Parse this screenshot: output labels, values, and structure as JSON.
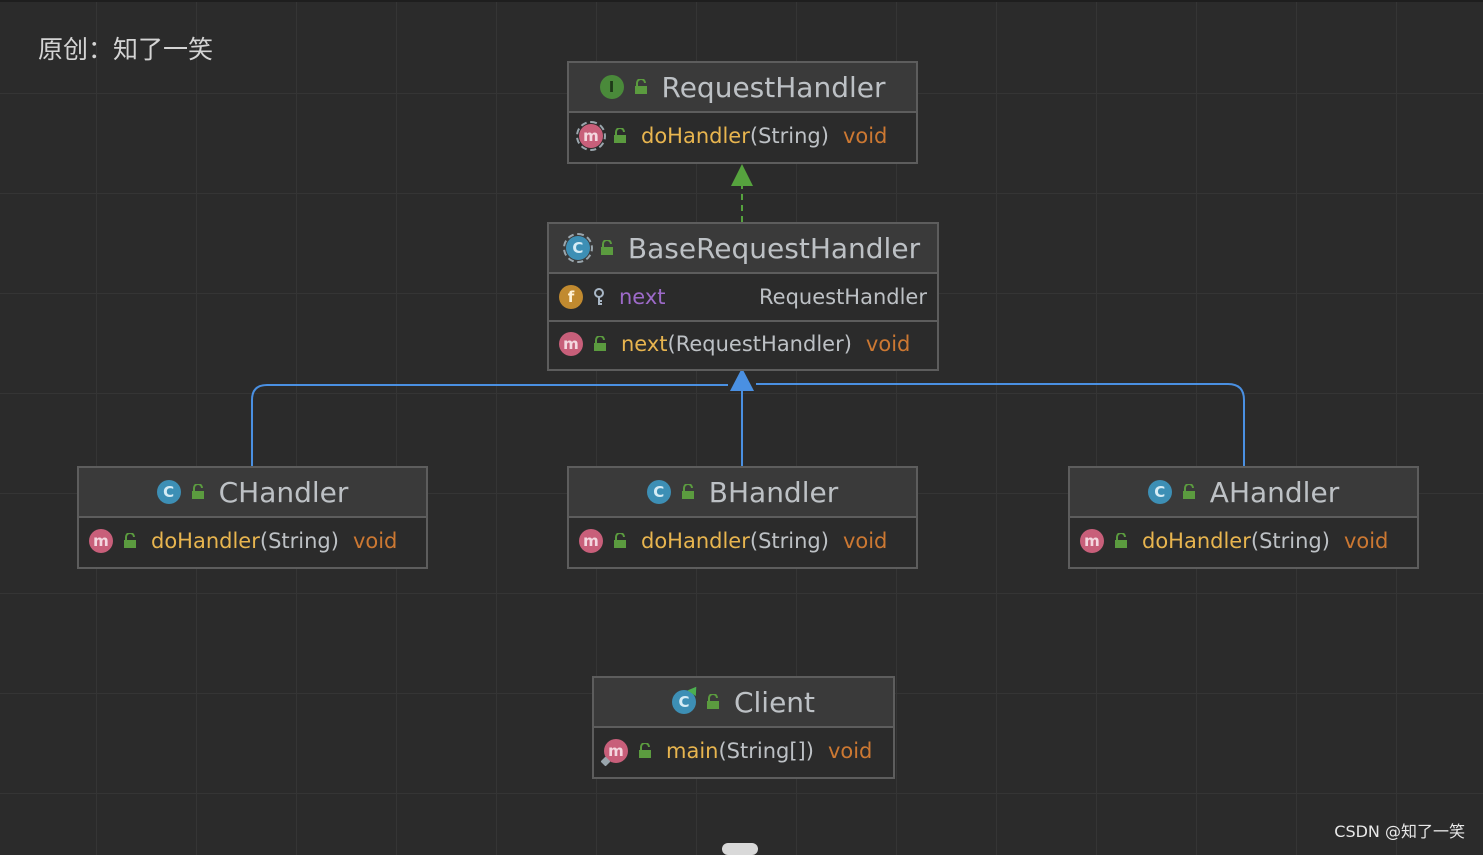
{
  "watermark": "原创：知了一笑",
  "footer_credit": "CSDN @知了一笑",
  "colors": {
    "background": "#2b2b2b",
    "implements_arrow": "#56a33e",
    "extends_arrow": "#4a90e2",
    "method_name": "#e8b54f",
    "return_type": "#cc7832",
    "field_name": "#9d6ac9"
  },
  "nodes": {
    "request_handler": {
      "name": "RequestHandler",
      "kind_badge": "I",
      "methods": [
        {
          "badge": "m",
          "name": "doHandler",
          "params": "(String)",
          "return_type": "void"
        }
      ]
    },
    "base_request_handler": {
      "name": "BaseRequestHandler",
      "kind_badge": "C",
      "fields": [
        {
          "badge": "f",
          "name": "next",
          "type": "RequestHandler"
        }
      ],
      "methods": [
        {
          "badge": "m",
          "name": "next",
          "params": "(RequestHandler)",
          "return_type": "void"
        }
      ]
    },
    "c_handler": {
      "name": "CHandler",
      "kind_badge": "C",
      "methods": [
        {
          "badge": "m",
          "name": "doHandler",
          "params": "(String)",
          "return_type": "void"
        }
      ]
    },
    "b_handler": {
      "name": "BHandler",
      "kind_badge": "C",
      "methods": [
        {
          "badge": "m",
          "name": "doHandler",
          "params": "(String)",
          "return_type": "void"
        }
      ]
    },
    "a_handler": {
      "name": "AHandler",
      "kind_badge": "C",
      "methods": [
        {
          "badge": "m",
          "name": "doHandler",
          "params": "(String)",
          "return_type": "void"
        }
      ]
    },
    "client": {
      "name": "Client",
      "kind_badge": "C",
      "methods": [
        {
          "badge": "m",
          "name": "main",
          "params": "(String[])",
          "return_type": "void"
        }
      ]
    }
  },
  "relations": [
    {
      "from": "BaseRequestHandler",
      "to": "RequestHandler",
      "type": "implements"
    },
    {
      "from": "CHandler",
      "to": "BaseRequestHandler",
      "type": "extends"
    },
    {
      "from": "BHandler",
      "to": "BaseRequestHandler",
      "type": "extends"
    },
    {
      "from": "AHandler",
      "to": "BaseRequestHandler",
      "type": "extends"
    }
  ]
}
